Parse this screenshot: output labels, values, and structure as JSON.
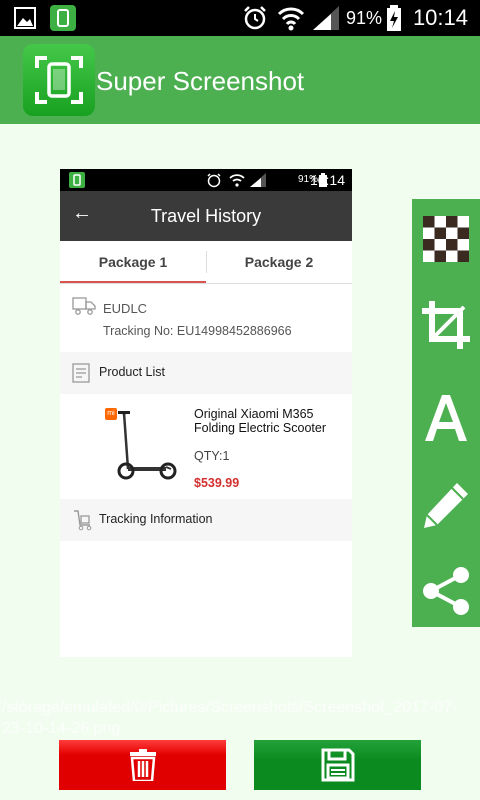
{
  "status_bar": {
    "battery": "91%",
    "time": "10:14"
  },
  "app": {
    "title": "Super Screenshot"
  },
  "preview": {
    "status_bar": {
      "battery": "91%",
      "time": "10:14"
    },
    "toolbar": {
      "title": "Travel History"
    },
    "tabs": [
      {
        "label": "Package 1"
      },
      {
        "label": "Package 2"
      }
    ],
    "shipment": {
      "carrier": "EUDLC",
      "tracking": "Tracking No: EU14998452886966"
    },
    "product_list_label": "Product List",
    "product": {
      "brand_badge": "mi",
      "name": "Original Xiaomi M365 Folding Electric Scooter",
      "qty": "QTY:1",
      "price": "$539.99"
    },
    "tracking_info_label": "Tracking Information"
  },
  "tools": [
    {
      "name": "mosaic",
      "icon": "checkerboard-icon"
    },
    {
      "name": "crop",
      "icon": "crop-icon"
    },
    {
      "name": "text",
      "icon": "text-a-icon"
    },
    {
      "name": "draw",
      "icon": "pencil-icon"
    },
    {
      "name": "share",
      "icon": "share-icon"
    }
  ],
  "file_path": "/storage/emulated/0/Pictures/Screenshots/Screenshot_2017-07-23-10-14-26.png",
  "buttons": {
    "delete": "trash-icon",
    "save": "floppy-save-icon"
  },
  "colors": {
    "accent": "#4caf50",
    "delete": "#e10000",
    "save": "#0b8a1f",
    "price": "#d32f2f"
  }
}
